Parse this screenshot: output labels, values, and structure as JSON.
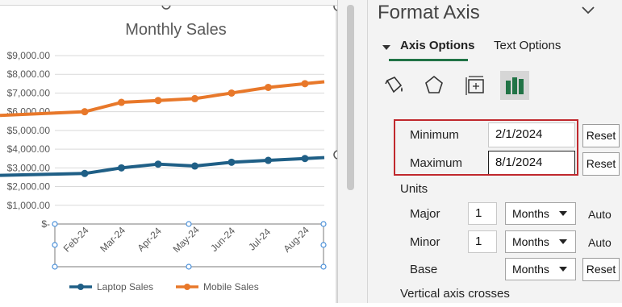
{
  "chart": {
    "title": "Monthly Sales",
    "legend": [
      "Laptop Sales",
      "Mobile Sales"
    ]
  },
  "chart_data": {
    "type": "line",
    "title": "Monthly Sales",
    "categories": [
      "Feb-24",
      "Mar-24",
      "Apr-24",
      "May-24",
      "Jun-24",
      "Jul-24",
      "Aug-24"
    ],
    "ytick_labels": [
      "$9,000.00",
      "$8,000.00",
      "$7,000.00",
      "$6,000.00",
      "$5,000.00",
      "$4,000.00",
      "$3,000.00",
      "$2,000.00",
      "$1,000.00",
      "$-"
    ],
    "ylim": [
      0,
      9000
    ],
    "grid": true,
    "legend_position": "bottom",
    "series": [
      {
        "name": "Laptop Sales",
        "color": "#1f5f86",
        "values": [
          2700,
          3000,
          3200,
          3100,
          3300,
          3400,
          3500
        ],
        "start": 2600,
        "end": 3550
      },
      {
        "name": "Mobile Sales",
        "color": "#e8782a",
        "values": [
          6000,
          6500,
          6600,
          6700,
          7000,
          7300,
          7500
        ],
        "start": 5800,
        "end": 7600
      }
    ]
  },
  "pane": {
    "title": "Format Axis",
    "tabs": [
      "Axis Options",
      "Text Options"
    ],
    "icons": [
      "fill-line-icon",
      "effects-icon",
      "size-properties-icon",
      "axis-options-icon"
    ],
    "minimum": {
      "label": "Minimum",
      "value": "2/1/2024",
      "button": "Reset"
    },
    "maximum": {
      "label": "Maximum",
      "value": "8/1/2024",
      "button": "Reset"
    },
    "units_label": "Units",
    "major": {
      "label": "Major",
      "value": "1",
      "unit": "Months",
      "state": "Auto"
    },
    "minor": {
      "label": "Minor",
      "value": "1",
      "unit": "Months",
      "state": "Auto"
    },
    "base": {
      "label": "Base",
      "unit": "Months",
      "button": "Reset"
    },
    "crosses_label": "Vertical axis crosses"
  }
}
